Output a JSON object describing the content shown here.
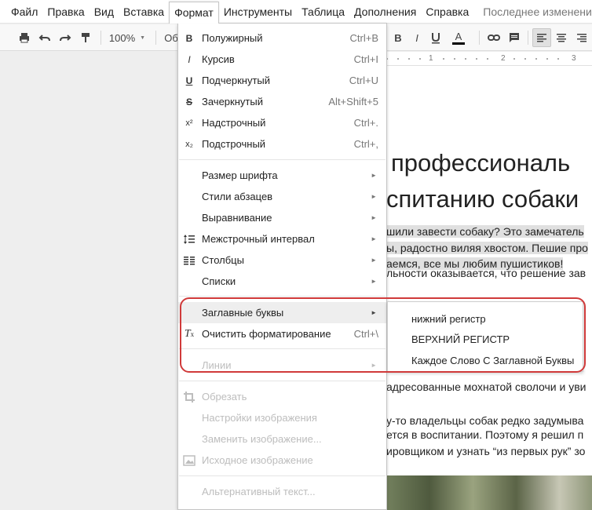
{
  "menubar": {
    "items": [
      "Файл",
      "Правка",
      "Вид",
      "Вставка",
      "Формат",
      "Инструменты",
      "Таблица",
      "Дополнения",
      "Справка"
    ],
    "active": "Формат",
    "status": "Последнее изменение"
  },
  "toolbar": {
    "zoom": "100%",
    "style_partial": "Об",
    "bold": "B",
    "italic": "I",
    "text_color": "A"
  },
  "ruler": {
    "numbers": [
      "1",
      "2",
      "3"
    ]
  },
  "format_menu": {
    "items": [
      {
        "label": "Полужирный",
        "shortcut": "Ctrl+B",
        "icon": "B"
      },
      {
        "label": "Курсив",
        "shortcut": "Ctrl+I",
        "icon": "I"
      },
      {
        "label": "Подчеркнутый",
        "shortcut": "Ctrl+U",
        "icon": "U"
      },
      {
        "label": "Зачеркнутый",
        "shortcut": "Alt+Shift+5",
        "icon": "S"
      },
      {
        "label": "Надстрочный",
        "shortcut": "Ctrl+.",
        "icon": "x²"
      },
      {
        "label": "Подстрочный",
        "shortcut": "Ctrl+,",
        "icon": "x₂"
      },
      {
        "label": "Размер шрифта"
      },
      {
        "label": "Стили абзацев"
      },
      {
        "label": "Выравнивание"
      },
      {
        "label": "Межстрочный интервал"
      },
      {
        "label": "Столбцы"
      },
      {
        "label": "Списки"
      },
      {
        "label": "Заглавные буквы"
      },
      {
        "label": "Очистить форматирование",
        "shortcut": "Ctrl+\\"
      },
      {
        "label": "Линии"
      },
      {
        "label": "Обрезать"
      },
      {
        "label": "Настройки изображения"
      },
      {
        "label": "Заменить изображение..."
      },
      {
        "label": "Исходное изображение"
      },
      {
        "label": "Альтернативный текст..."
      }
    ],
    "submenu_arrow": "►"
  },
  "case_submenu": {
    "items": [
      "нижний регистр",
      "ВЕРХНИЙ РЕГИСТР",
      "Каждое Слово С Заглавной Буквы"
    ]
  },
  "document": {
    "title_line1": "профессиональ",
    "title_line2": "спитанию собаки",
    "lines": [
      "шили завести собаку? Это замечатель",
      "ы, радостно виляя хвостом. Пешие про",
      "аемся, все мы любим пушистиков!",
      "льности оказывается, что решение зав",
      "адресованные мохнатой сволочи и уви",
      "у-то владельцы собак редко задумыва",
      "ется в воспитании. Поэтому я решил п",
      "ировщиком и узнать “из первых рук” зо"
    ]
  },
  "colors": {
    "annotation": "#d03a3a",
    "hover": "#eeeeee",
    "disabled_text": "#bdbdbd"
  }
}
